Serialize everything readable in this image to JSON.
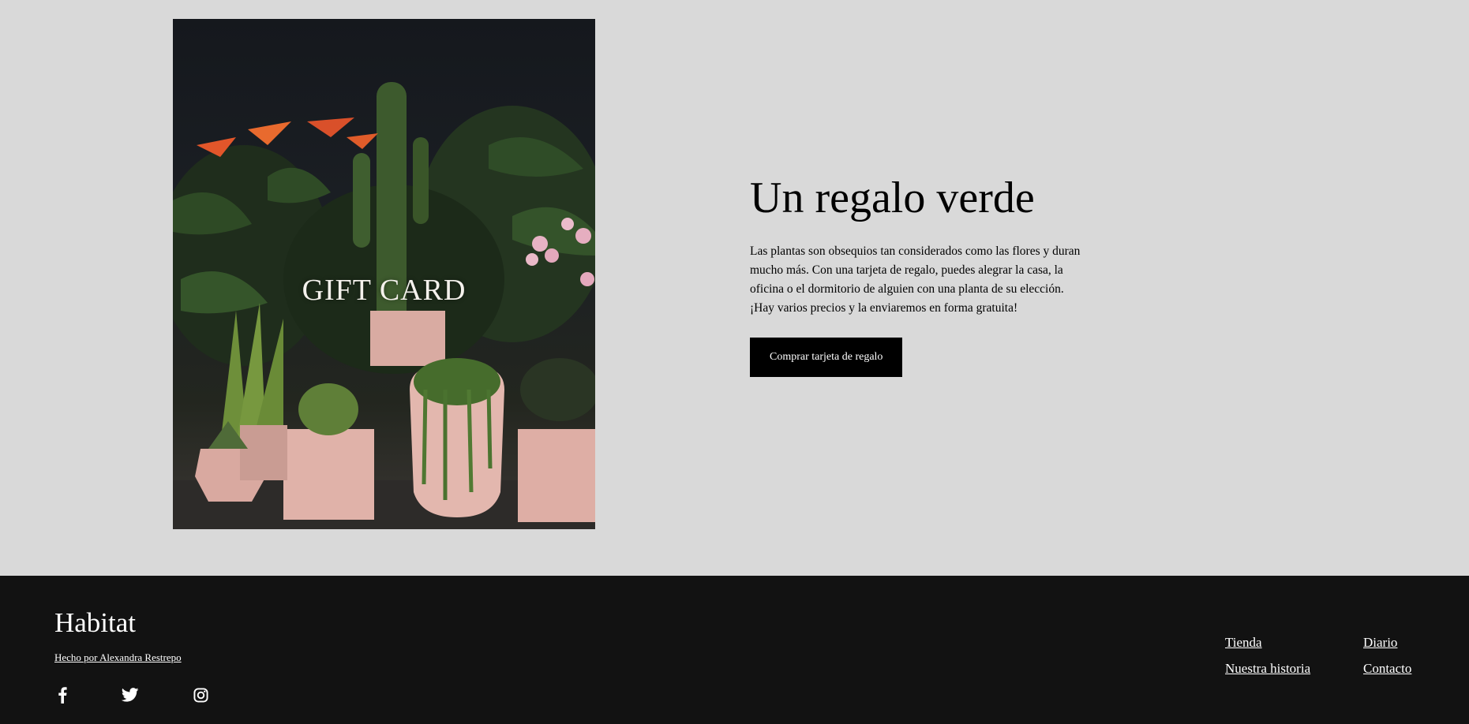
{
  "hero": {
    "image_text": "GIFT CARD",
    "title": "Un regalo verde",
    "description": "Las plantas son obsequios tan considerados como las flores y duran mucho más. Con una tarjeta de regalo, puedes alegrar la casa, la oficina o el dormitorio de alguien con una planta de su elección. ¡Hay varios precios y la enviaremos en forma gratuita!",
    "button_label": "Comprar tarjeta de regalo"
  },
  "footer": {
    "brand": "Habitat",
    "credit": "Hecho por Alexandra Restrepo",
    "socials": [
      {
        "icon": "facebook-icon"
      },
      {
        "icon": "twitter-icon"
      },
      {
        "icon": "instagram-icon"
      }
    ],
    "links": {
      "tienda": "Tienda",
      "nuestra_historia": "Nuestra historia",
      "diario": "Diario",
      "contacto": "Contacto"
    }
  },
  "colors": {
    "page_background": "#d9d9d9",
    "footer_background": "#121212",
    "button_background": "#000000",
    "text": "#000000",
    "footer_text": "#ffffff"
  }
}
